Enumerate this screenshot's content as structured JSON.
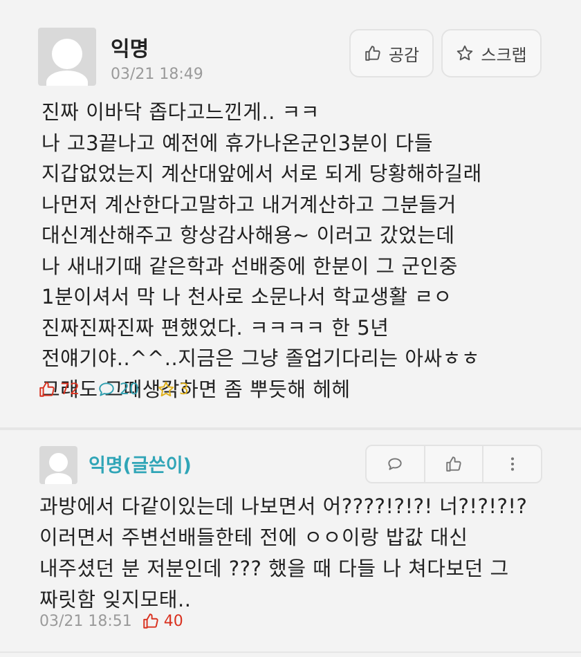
{
  "post": {
    "author": "익명",
    "time": "03/21 18:49",
    "vote_label": "공감",
    "scrap_label": "스크랩",
    "lines": [
      "진짜 이바닥 좁다고느낀게.. ㅋㅋ",
      "나 고3끝나고 예전에 휴가나온군인3분이 다들",
      "지갑없었는지 계산대앞에서 서로 되게 당황해하길래",
      "나먼저 계산한다고말하고 내거계산하고 그분들거",
      "대신계산해주고 항상감사해용~ 이러고 갔었는데",
      "나 새내기때 같은학과 선배중에 한분이 그 군인중",
      "1분이셔서 막 나 천사로 소문나서 학교생활 ㄹㅇ",
      "진짜진짜진짜 편했었다. ㅋㅋㅋㅋ 한 5년",
      "전얘기야..^^..지금은 그냥 졸업기다리는 아싸ㅎㅎ",
      "그래도 그때생각하면 좀 뿌듯해 헤헤"
    ],
    "like_count": "72",
    "comment_count": "20",
    "scrap_count": "3"
  },
  "comment": {
    "author": "익명(글쓴이)",
    "lines": [
      "과방에서 다같이있는데 나보면서 어????!?!?! 너?!?!?!?",
      "이러면서 주변선배들한테 전에 ㅇㅇ이랑 밥값 대신",
      "내주셨던 분 저분인데 ??? 했을 때 다들 나 쳐다보던 그",
      "짜릿함 잊지모태.."
    ],
    "time": "03/21 18:51",
    "like_count": "40"
  },
  "colors": {
    "like": "#d9311f",
    "comment": "#2f9fb0",
    "scrap": "#e0b11a",
    "comment_author": "#30a5b7"
  },
  "icons": [
    "thumbs-up-icon",
    "star-icon",
    "speech-bubble-icon",
    "more-vertical-icon"
  ]
}
